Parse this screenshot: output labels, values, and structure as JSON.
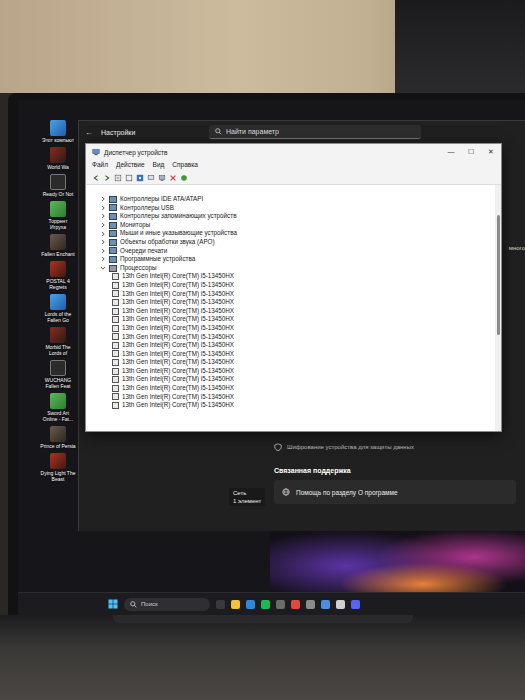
{
  "desktop": {
    "icons": [
      {
        "label": "Этот компьют"
      },
      {
        "label": "World Wa"
      },
      {
        "label": "Ready Or Not"
      },
      {
        "label": "Торрент Игруха"
      },
      {
        "label": "Fallen Enchant"
      },
      {
        "label": "POSTAL 4 Regrets"
      },
      {
        "label": "Lords of the Fallen Go"
      },
      {
        "label": "Morbid The Lords of"
      },
      {
        "label": "WUCHANG Fallen Feat"
      },
      {
        "label": "Sword Art Online - Fat..."
      },
      {
        "label": "Prince of Persia"
      },
      {
        "label": "Dying Light The Beast"
      }
    ]
  },
  "settings_window": {
    "title": "Настройки",
    "back": "←",
    "search": {
      "placeholder": "Найти параметр"
    },
    "clipped_text": "много",
    "encryption_item": "Шифрование устройства для защиты данных",
    "section_title": "Связанная поддержка",
    "help_item": "Помощь по разделу О программе",
    "status": {
      "nav_label": "Сеть",
      "count": "1 элемент"
    }
  },
  "device_manager": {
    "title": "Диспетчер устройств",
    "controls": [
      "—",
      "☐",
      "✕"
    ],
    "menu": [
      "Файл",
      "Действие",
      "Вид",
      "Справка"
    ],
    "tree": [
      {
        "kind": "category",
        "label": "Контроллеры IDE ATA/ATAPI",
        "expanded": false
      },
      {
        "kind": "category",
        "label": "Контроллеры USB",
        "expanded": false
      },
      {
        "kind": "category",
        "label": "Контроллеры запоминающих устройств",
        "expanded": false
      },
      {
        "kind": "category",
        "label": "Мониторы",
        "expanded": false
      },
      {
        "kind": "category",
        "label": "Мыши и иные указывающие устройства",
        "expanded": false
      },
      {
        "kind": "category",
        "label": "Объекты обработки звука (APO)",
        "expanded": false
      },
      {
        "kind": "category",
        "label": "Очереди печати",
        "expanded": false
      },
      {
        "kind": "category",
        "label": "Программные устройства",
        "expanded": false
      },
      {
        "kind": "category",
        "label": "Процессоры",
        "expanded": true
      },
      {
        "kind": "device",
        "label": "13th Gen Intel(R) Core(TM) i5-13450HX"
      },
      {
        "kind": "device",
        "label": "13th Gen Intel(R) Core(TM) i5-13450HX"
      },
      {
        "kind": "device",
        "label": "13th Gen Intel(R) Core(TM) i5-13450HX"
      },
      {
        "kind": "device",
        "label": "13th Gen Intel(R) Core(TM) i5-13450HX"
      },
      {
        "kind": "device",
        "label": "13th Gen Intel(R) Core(TM) i5-13450HX"
      },
      {
        "kind": "device",
        "label": "13th Gen Intel(R) Core(TM) i5-13450HX"
      },
      {
        "kind": "device",
        "label": "13th Gen Intel(R) Core(TM) i5-13450HX"
      },
      {
        "kind": "device",
        "label": "13th Gen Intel(R) Core(TM) i5-13450HX"
      },
      {
        "kind": "device",
        "label": "13th Gen Intel(R) Core(TM) i5-13450HX"
      },
      {
        "kind": "device",
        "label": "13th Gen Intel(R) Core(TM) i5-13450HX"
      },
      {
        "kind": "device",
        "label": "13th Gen Intel(R) Core(TM) i5-13450HX"
      },
      {
        "kind": "device",
        "label": "13th Gen Intel(R) Core(TM) i5-13450HX"
      },
      {
        "kind": "device",
        "label": "13th Gen Intel(R) Core(TM) i5-13450HX"
      },
      {
        "kind": "device",
        "label": "13th Gen Intel(R) Core(TM) i5-13450HX"
      },
      {
        "kind": "device",
        "label": "13th Gen Intel(R) Core(TM) i5-13450HX"
      },
      {
        "kind": "device",
        "label": "13th Gen Intel(R) Core(TM) i5-13450HX"
      }
    ]
  },
  "taskbar": {
    "search": {
      "placeholder": "Поиск"
    }
  }
}
